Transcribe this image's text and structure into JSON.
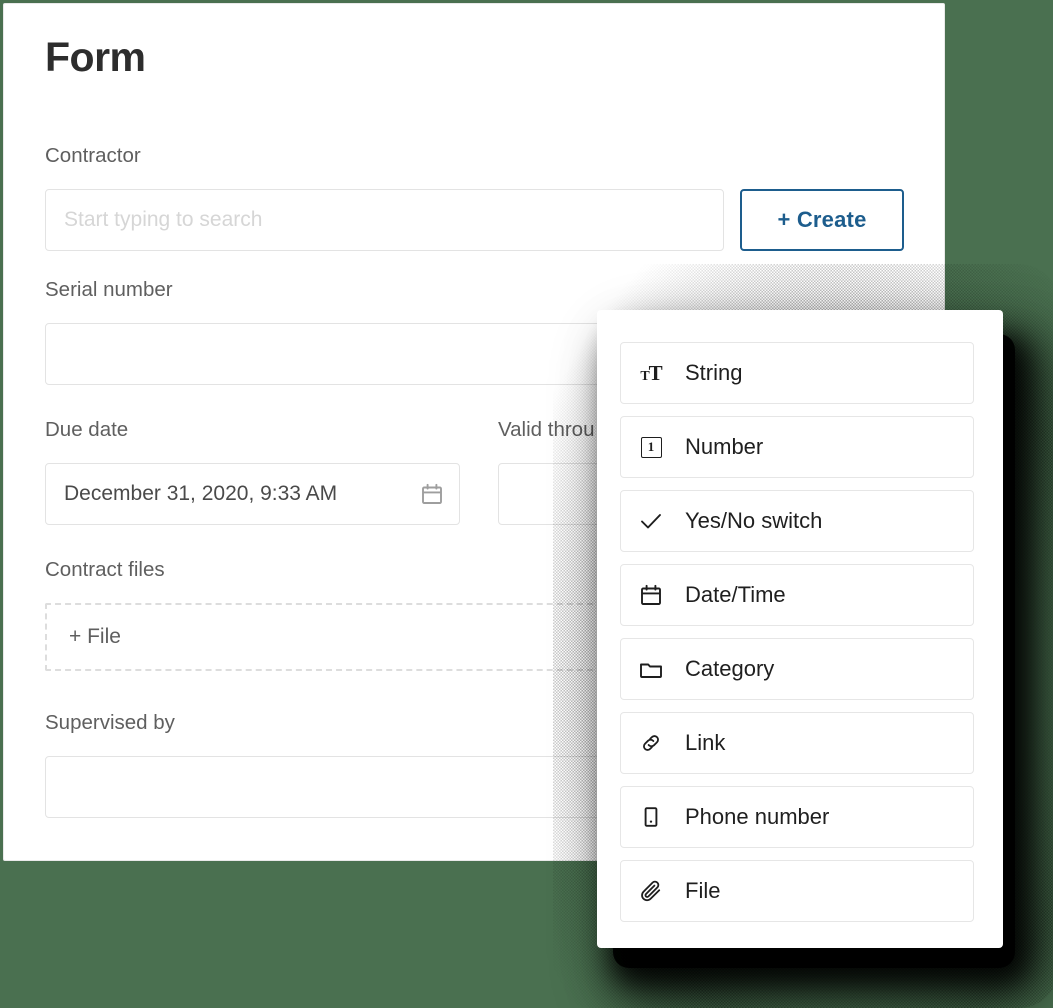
{
  "theme": {
    "background": "#4a7050",
    "card_background": "#ffffff",
    "accent_blue": "#1d5d8d",
    "label_gray": "#5f5f5f",
    "border_gray": "#e3e3e3",
    "placeholder_gray": "#d6d6d6"
  },
  "form": {
    "title": "Form",
    "fields": {
      "contractor": {
        "label": "Contractor",
        "value": "",
        "placeholder": "Start typing to search",
        "create_button": "+ Create"
      },
      "serial_number": {
        "label": "Serial number",
        "value": "",
        "placeholder": ""
      },
      "due_date": {
        "label": "Due date",
        "value": "December 31, 2020, 9:33 AM",
        "placeholder": "",
        "icon": "calendar-icon"
      },
      "valid_through": {
        "label": "Valid throu",
        "value": "",
        "placeholder": ""
      },
      "contract_files": {
        "label": "Contract files",
        "add_label": "+ File"
      },
      "supervised_by": {
        "label": "Supervised by",
        "value": "",
        "placeholder": ""
      }
    }
  },
  "type_popup": {
    "items": [
      {
        "label": "String",
        "icon": "text-format-icon"
      },
      {
        "label": "Number",
        "icon": "number-box-icon"
      },
      {
        "label": "Yes/No switch",
        "icon": "check-icon"
      },
      {
        "label": "Date/Time",
        "icon": "calendar-icon"
      },
      {
        "label": "Category",
        "icon": "folder-icon"
      },
      {
        "label": "Link",
        "icon": "link-icon"
      },
      {
        "label": "Phone number",
        "icon": "phone-icon"
      },
      {
        "label": "File",
        "icon": "paperclip-icon"
      }
    ]
  }
}
